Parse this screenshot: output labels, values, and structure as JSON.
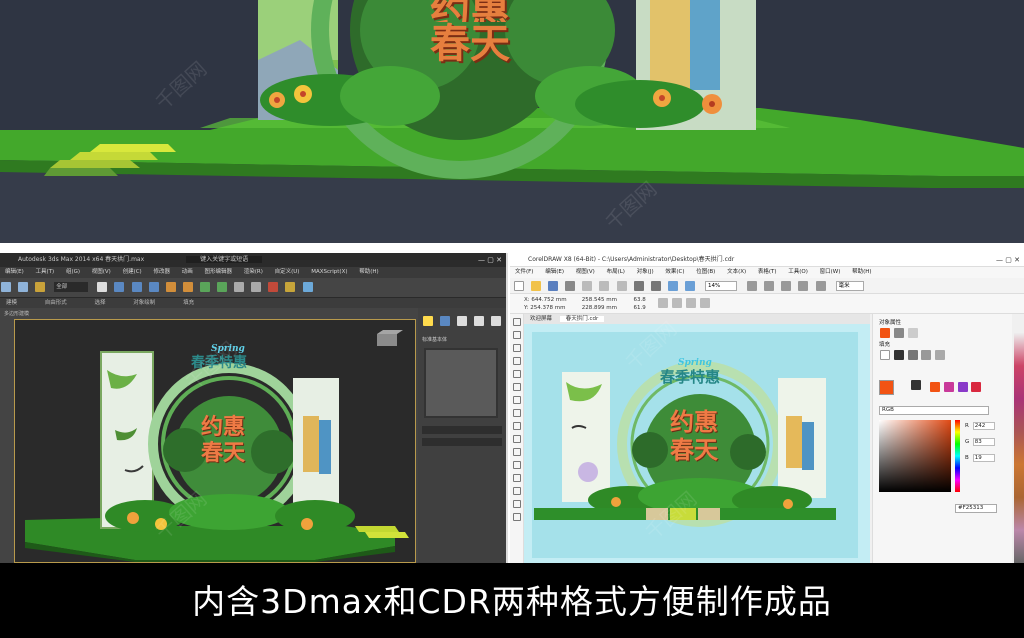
{
  "caption": "内含3Dmax和CDR两种格式方便制作成品",
  "watermark": "千图网",
  "stage_art": {
    "spring_word": "Spring",
    "promo_title": "春季特惠",
    "main_line1": "约惠",
    "main_line2": "春天"
  },
  "max_window": {
    "title": "Autodesk 3ds Max 2014 x64    春天拱门.max",
    "search_placeholder": "键入关键字或短语",
    "menus": [
      "编辑(E)",
      "工具(T)",
      "组(G)",
      "视图(V)",
      "创建(C)",
      "修改器",
      "动画",
      "图形编辑器",
      "渲染(R)",
      "自定义(U)",
      "MAXScript(X)",
      "帮助(H)"
    ],
    "ribbon_tabs": [
      "建模",
      "自由形式",
      "选择",
      "对象绘制",
      "填充"
    ],
    "sub_label": "多边形建模",
    "select_value": "全部",
    "rollout_label": "标准基本体"
  },
  "cdr_window": {
    "title": "CorelDRAW X8 (64-Bit) - C:\\Users\\Administrator\\Desktop\\春天拱门.cdr",
    "menus": [
      "文件(F)",
      "编辑(E)",
      "视图(V)",
      "布局(L)",
      "对象(J)",
      "效果(C)",
      "位图(B)",
      "文本(X)",
      "表格(T)",
      "工具(O)",
      "窗口(W)",
      "帮助(H)"
    ],
    "zoom": "14%",
    "unit": "毫米",
    "coords": {
      "x": "X: 644.752 mm",
      "y": "Y: 254.378 mm",
      "w": "258.545 mm",
      "h": "228.899 mm",
      "sx": "63.8",
      "sy": "61.9"
    },
    "tabs": [
      "欢迎屏幕",
      "春天拱门.cdr"
    ],
    "docker_title": "对象属性",
    "fill_label": "填充",
    "color_model": "RGB",
    "rgb": {
      "r": "242",
      "g": "83",
      "b": "19"
    },
    "hex": "#F25313",
    "accent_color": "#f25313"
  }
}
